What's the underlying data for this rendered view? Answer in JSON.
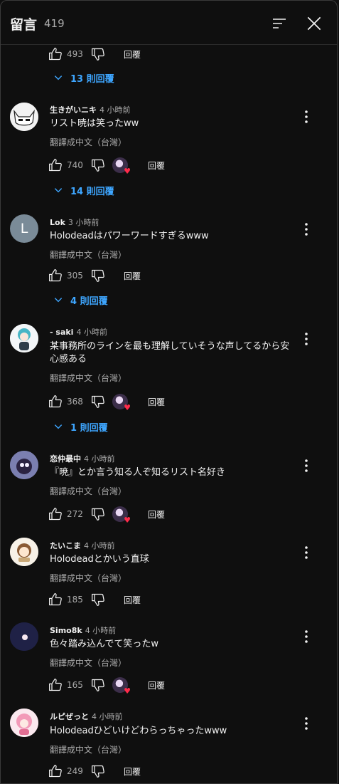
{
  "header": {
    "title": "留言",
    "count": "419"
  },
  "top_thread": {
    "likes": "493",
    "reply_label": "回覆",
    "replies_toggle": "13 則回覆"
  },
  "comments": [
    {
      "author": "生きがいニキ",
      "time": "4 小時前",
      "text": "リスト暁は笑ったww",
      "translate": "翻譯成中文（台灣）",
      "likes": "740",
      "reply_label": "回覆",
      "replies_toggle": "14 則回覆"
    },
    {
      "author": "Lok",
      "time": "3 小時前",
      "text": "Holodeadはパワーワードすぎるwww",
      "translate": "翻譯成中文（台灣）",
      "likes": "305",
      "reply_label": "回覆",
      "replies_toggle": "4 則回覆",
      "avatar_letter": "L"
    },
    {
      "author": "- saki",
      "time": "4 小時前",
      "text": "某事務所のラインを最も理解していそうな声してるから安心感ある",
      "translate": "翻譯成中文（台灣）",
      "likes": "368",
      "reply_label": "回覆",
      "replies_toggle": "1 則回覆"
    },
    {
      "author": "恋仲最中",
      "time": "4 小時前",
      "text": "『暁』とか言う知る人ぞ知るリスト名好き",
      "translate": "翻譯成中文（台灣）",
      "likes": "272",
      "reply_label": "回覆"
    },
    {
      "author": "たいこま",
      "time": "4 小時前",
      "text": "Holodeadとかいう直球",
      "translate": "翻譯成中文（台灣）",
      "likes": "185",
      "reply_label": "回覆"
    },
    {
      "author": "Simo8k",
      "time": "4 小時前",
      "text": "色々踏み込んでて笑ったw",
      "translate": "翻譯成中文（台灣）",
      "likes": "165",
      "reply_label": "回覆"
    },
    {
      "author": "ルピぜっと",
      "time": "4 小時前",
      "text": "Holodeadひどいけどわらっちゃったwww",
      "translate": "翻譯成中文（台灣）",
      "likes": "249",
      "reply_label": "回覆"
    }
  ],
  "colors": {
    "background": "#0f0f0f",
    "text": "#f1f1f1",
    "secondary": "#aaaaaa",
    "link": "#3ea6ff",
    "heart": "#ff2b4a"
  }
}
